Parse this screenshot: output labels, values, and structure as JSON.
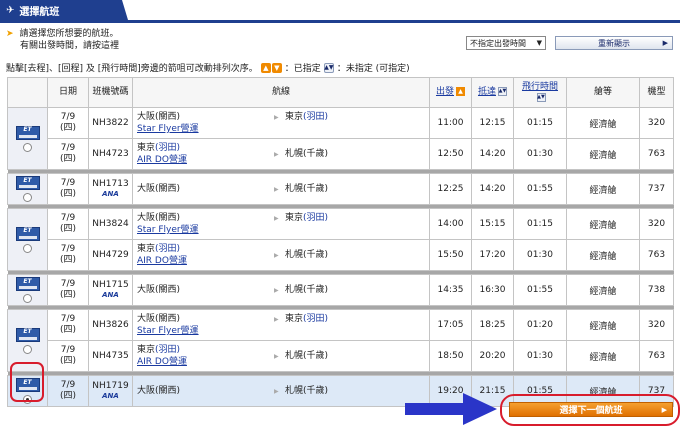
{
  "header": {
    "title": "選擇航班",
    "plane_icon": "airplane-icon"
  },
  "instructions": {
    "line1": "請選擇您所想要的航班。",
    "line2": "有關出發時間，請按這裡"
  },
  "time_select": {
    "value": "不指定出發時間",
    "options": [
      "不指定出發時間"
    ]
  },
  "refresh_button": {
    "label": "重新顯示"
  },
  "sort_note": {
    "prefix": "點擊[去程]、[回程] 及 [飛行時間]旁邊的箭咀可改動排列次序。",
    "set_label": "：已指定",
    "unset_label": "：未指定 (可指定)"
  },
  "table": {
    "headers": {
      "date": "日期",
      "flight": "班機號碼",
      "route": "航線",
      "depart": "出發",
      "arrive": "抵達",
      "duration": "飛行時間",
      "cabin": "艙等",
      "aircraft": "機型"
    },
    "groups": [
      {
        "selected": false,
        "segments": [
          {
            "date": "7/9",
            "day": "(四)",
            "flight": "NH3822",
            "from": "大阪(關西)",
            "carrier": "Star Flyer營運",
            "to_city": "東京",
            "to_airport": "(羽田)",
            "depart": "11:00",
            "arrive": "12:15",
            "duration": "01:15",
            "cabin": "經濟艙",
            "aircraft": "320"
          },
          {
            "date": "7/9",
            "day": "(四)",
            "flight": "NH4723",
            "from_city": "東京",
            "from_airport": "(羽田)",
            "carrier": "AIR DO營運",
            "to": "札幌(千歲)",
            "depart": "12:50",
            "arrive": "14:20",
            "duration": "01:30",
            "cabin": "經濟艙",
            "aircraft": "763"
          }
        ]
      },
      {
        "selected": false,
        "segments": [
          {
            "date": "7/9",
            "day": "(四)",
            "flight": "NH1713",
            "logo": "ANA",
            "from": "大阪(關西)",
            "to": "札幌(千歲)",
            "depart": "12:25",
            "arrive": "14:20",
            "duration": "01:55",
            "cabin": "經濟艙",
            "aircraft": "737"
          }
        ]
      },
      {
        "selected": false,
        "segments": [
          {
            "date": "7/9",
            "day": "(四)",
            "flight": "NH3824",
            "from": "大阪(關西)",
            "carrier": "Star Flyer營運",
            "to_city": "東京",
            "to_airport": "(羽田)",
            "depart": "14:00",
            "arrive": "15:15",
            "duration": "01:15",
            "cabin": "經濟艙",
            "aircraft": "320"
          },
          {
            "date": "7/9",
            "day": "(四)",
            "flight": "NH4729",
            "from_city": "東京",
            "from_airport": "(羽田)",
            "carrier": "AIR DO營運",
            "to": "札幌(千歲)",
            "depart": "15:50",
            "arrive": "17:20",
            "duration": "01:30",
            "cabin": "經濟艙",
            "aircraft": "763"
          }
        ]
      },
      {
        "selected": false,
        "segments": [
          {
            "date": "7/9",
            "day": "(四)",
            "flight": "NH1715",
            "logo": "ANA",
            "from": "大阪(關西)",
            "to": "札幌(千歲)",
            "depart": "14:35",
            "arrive": "16:30",
            "duration": "01:55",
            "cabin": "經濟艙",
            "aircraft": "738"
          }
        ]
      },
      {
        "selected": false,
        "segments": [
          {
            "date": "7/9",
            "day": "(四)",
            "flight": "NH3826",
            "from": "大阪(關西)",
            "carrier": "Star Flyer營運",
            "to_city": "東京",
            "to_airport": "(羽田)",
            "depart": "17:05",
            "arrive": "18:25",
            "duration": "01:20",
            "cabin": "經濟艙",
            "aircraft": "320"
          },
          {
            "date": "7/9",
            "day": "(四)",
            "flight": "NH4735",
            "from_city": "東京",
            "from_airport": "(羽田)",
            "carrier": "AIR DO營運",
            "to": "札幌(千歲)",
            "depart": "18:50",
            "arrive": "20:20",
            "duration": "01:30",
            "cabin": "經濟艙",
            "aircraft": "763"
          }
        ]
      },
      {
        "selected": true,
        "segments": [
          {
            "date": "7/9",
            "day": "(四)",
            "flight": "NH1719",
            "logo": "ANA",
            "from": "大阪(關西)",
            "to": "札幌(千歲)",
            "depart": "19:20",
            "arrive": "21:15",
            "duration": "01:55",
            "cabin": "經濟艙",
            "aircraft": "737"
          }
        ]
      }
    ]
  },
  "next_button": {
    "label": "選擇下一個航班"
  },
  "colors": {
    "header_blue": "#1f3f8f",
    "accent_orange": "#f08a00",
    "highlight_red": "#d81c2c",
    "arrow_blue": "#2a35c8"
  }
}
